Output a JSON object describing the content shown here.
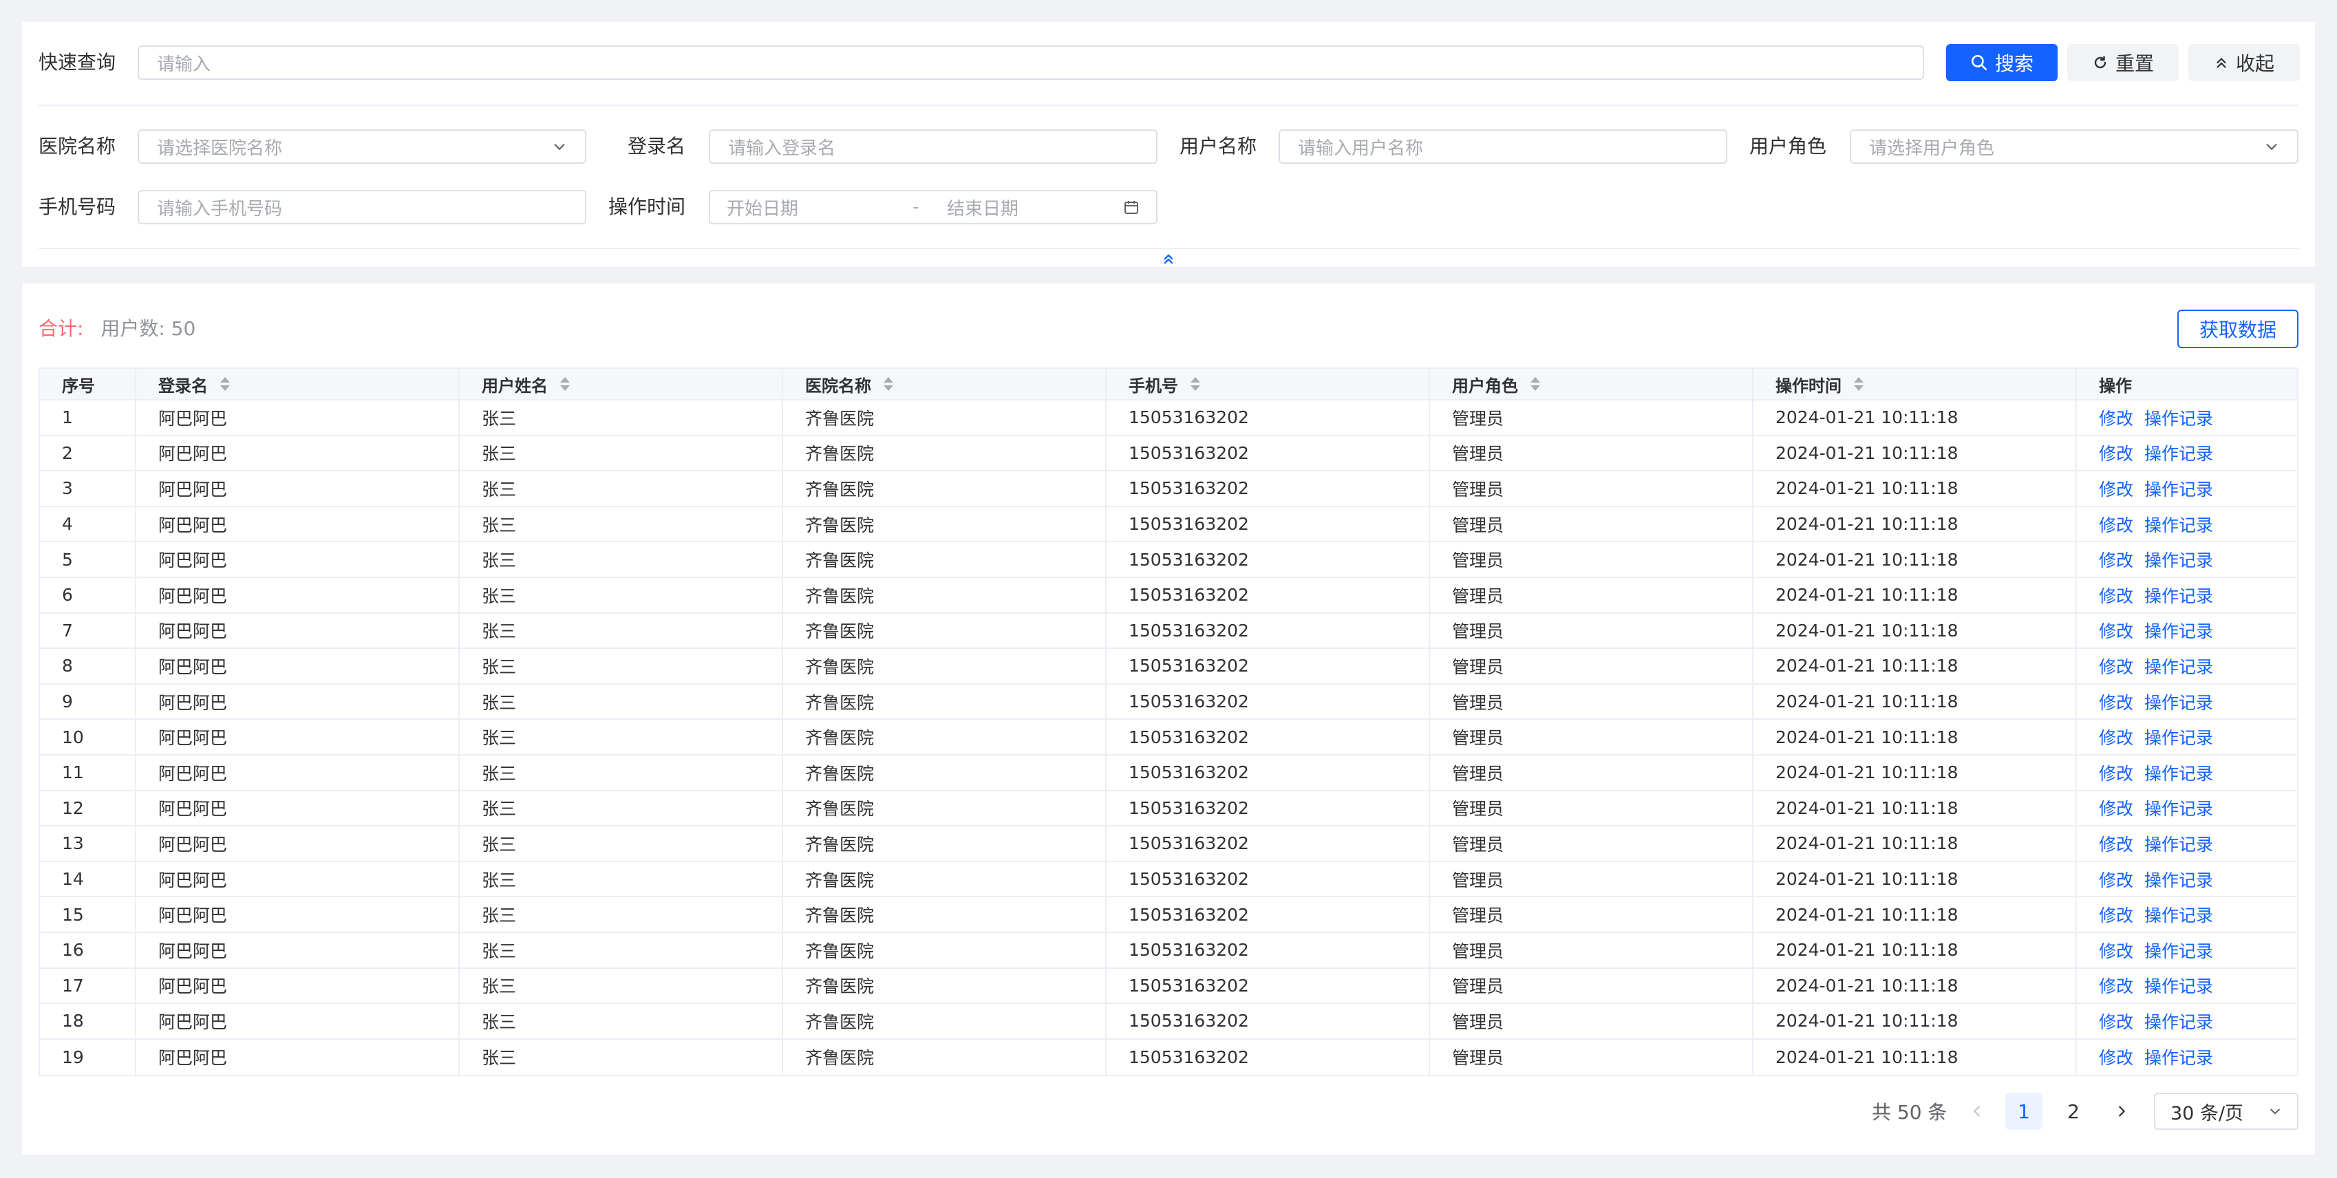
{
  "filters": {
    "quick_label": "快速查询",
    "quick_placeholder": "请输入",
    "search_label": "搜索",
    "reset_label": "重置",
    "collapse_label": "收起",
    "hospital_label": "医院名称",
    "hospital_placeholder": "请选择医院名称",
    "login_label": "登录名",
    "login_placeholder": "请输入登录名",
    "username_label": "用户名称",
    "username_placeholder": "请输入用户名称",
    "role_label": "用户角色",
    "role_placeholder": "请选择用户角色",
    "phone_label": "手机号码",
    "phone_placeholder": "请输入手机号码",
    "optime_label": "操作时间",
    "start_placeholder": "开始日期",
    "range_sep": "-",
    "end_placeholder": "结束日期"
  },
  "summary": {
    "total_label": "合计:",
    "user_count": "用户数: 50",
    "fetch_label": "获取数据"
  },
  "table": {
    "columns": [
      "序号",
      "登录名",
      "用户姓名",
      "医院名称",
      "手机号",
      "用户角色",
      "操作时间",
      "操作"
    ],
    "row_actions": [
      "修改",
      "操作记录"
    ],
    "rows": [
      [
        "1",
        "阿巴阿巴",
        "张三",
        "齐鲁医院",
        "15053163202",
        "管理员",
        "2024-01-21 10:11:18"
      ],
      [
        "2",
        "阿巴阿巴",
        "张三",
        "齐鲁医院",
        "15053163202",
        "管理员",
        "2024-01-21 10:11:18"
      ],
      [
        "3",
        "阿巴阿巴",
        "张三",
        "齐鲁医院",
        "15053163202",
        "管理员",
        "2024-01-21 10:11:18"
      ],
      [
        "4",
        "阿巴阿巴",
        "张三",
        "齐鲁医院",
        "15053163202",
        "管理员",
        "2024-01-21 10:11:18"
      ],
      [
        "5",
        "阿巴阿巴",
        "张三",
        "齐鲁医院",
        "15053163202",
        "管理员",
        "2024-01-21 10:11:18"
      ],
      [
        "6",
        "阿巴阿巴",
        "张三",
        "齐鲁医院",
        "15053163202",
        "管理员",
        "2024-01-21 10:11:18"
      ],
      [
        "7",
        "阿巴阿巴",
        "张三",
        "齐鲁医院",
        "15053163202",
        "管理员",
        "2024-01-21 10:11:18"
      ],
      [
        "8",
        "阿巴阿巴",
        "张三",
        "齐鲁医院",
        "15053163202",
        "管理员",
        "2024-01-21 10:11:18"
      ],
      [
        "9",
        "阿巴阿巴",
        "张三",
        "齐鲁医院",
        "15053163202",
        "管理员",
        "2024-01-21 10:11:18"
      ],
      [
        "10",
        "阿巴阿巴",
        "张三",
        "齐鲁医院",
        "15053163202",
        "管理员",
        "2024-01-21 10:11:18"
      ],
      [
        "11",
        "阿巴阿巴",
        "张三",
        "齐鲁医院",
        "15053163202",
        "管理员",
        "2024-01-21 10:11:18"
      ],
      [
        "12",
        "阿巴阿巴",
        "张三",
        "齐鲁医院",
        "15053163202",
        "管理员",
        "2024-01-21 10:11:18"
      ],
      [
        "13",
        "阿巴阿巴",
        "张三",
        "齐鲁医院",
        "15053163202",
        "管理员",
        "2024-01-21 10:11:18"
      ],
      [
        "14",
        "阿巴阿巴",
        "张三",
        "齐鲁医院",
        "15053163202",
        "管理员",
        "2024-01-21 10:11:18"
      ],
      [
        "15",
        "阿巴阿巴",
        "张三",
        "齐鲁医院",
        "15053163202",
        "管理员",
        "2024-01-21 10:11:18"
      ],
      [
        "16",
        "阿巴阿巴",
        "张三",
        "齐鲁医院",
        "15053163202",
        "管理员",
        "2024-01-21 10:11:18"
      ],
      [
        "17",
        "阿巴阿巴",
        "张三",
        "齐鲁医院",
        "15053163202",
        "管理员",
        "2024-01-21 10:11:18"
      ],
      [
        "18",
        "阿巴阿巴",
        "张三",
        "齐鲁医院",
        "15053163202",
        "管理员",
        "2024-01-21 10:11:18"
      ],
      [
        "19",
        "阿巴阿巴",
        "张三",
        "齐鲁医院",
        "15053163202",
        "管理员",
        "2024-01-21 10:11:18"
      ]
    ]
  },
  "pagination": {
    "total_text": "共 50 条",
    "pages": [
      "1",
      "2"
    ],
    "current_page": "1",
    "page_size": "30 条/页"
  },
  "colors": {
    "primary": "#1463ff",
    "total_label": "#f56c6c"
  }
}
